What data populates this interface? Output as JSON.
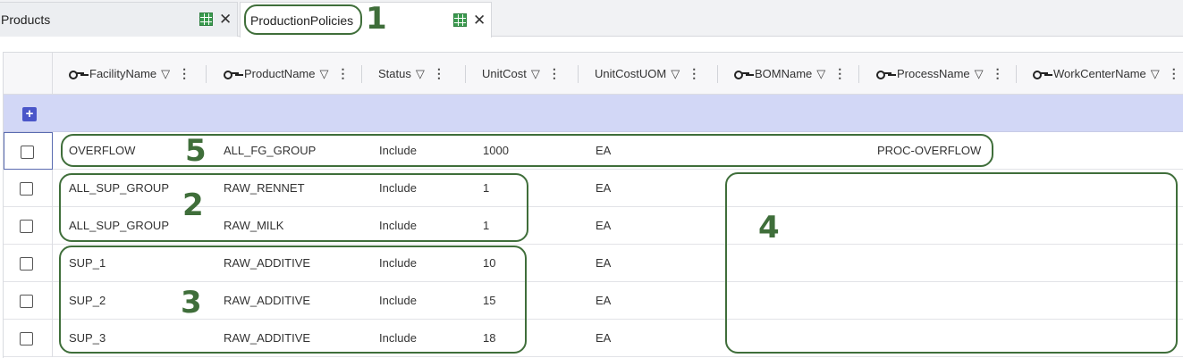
{
  "tabs": [
    {
      "label": "Products"
    },
    {
      "label": "ProductionPolicies"
    }
  ],
  "columns": [
    {
      "label": "FacilityName",
      "key": true
    },
    {
      "label": "ProductName",
      "key": true
    },
    {
      "label": "Status",
      "key": false
    },
    {
      "label": "UnitCost",
      "key": false
    },
    {
      "label": "UnitCostUOM",
      "key": false
    },
    {
      "label": "BOMName",
      "key": true
    },
    {
      "label": "ProcessName",
      "key": true
    },
    {
      "label": "WorkCenterName",
      "key": true
    }
  ],
  "rows": [
    {
      "facility": "OVERFLOW",
      "product": "ALL_FG_GROUP",
      "status": "Include",
      "unit_cost": "1000",
      "uom": "EA",
      "bom": "",
      "process": "PROC-OVERFLOW",
      "work_center": ""
    },
    {
      "facility": "ALL_SUP_GROUP",
      "product": "RAW_RENNET",
      "status": "Include",
      "unit_cost": "1",
      "uom": "EA",
      "bom": "",
      "process": "",
      "work_center": ""
    },
    {
      "facility": "ALL_SUP_GROUP",
      "product": "RAW_MILK",
      "status": "Include",
      "unit_cost": "1",
      "uom": "EA",
      "bom": "",
      "process": "",
      "work_center": ""
    },
    {
      "facility": "SUP_1",
      "product": "RAW_ADDITIVE",
      "status": "Include",
      "unit_cost": "10",
      "uom": "EA",
      "bom": "",
      "process": "",
      "work_center": ""
    },
    {
      "facility": "SUP_2",
      "product": "RAW_ADDITIVE",
      "status": "Include",
      "unit_cost": "15",
      "uom": "EA",
      "bom": "",
      "process": "",
      "work_center": ""
    },
    {
      "facility": "SUP_3",
      "product": "RAW_ADDITIVE",
      "status": "Include",
      "unit_cost": "18",
      "uom": "EA",
      "bom": "",
      "process": "",
      "work_center": ""
    }
  ],
  "annotations": {
    "n1": "1",
    "n2": "2",
    "n3": "3",
    "n4": "4",
    "n5": "5"
  },
  "colors": {
    "annotation": "#3f6e3a",
    "add_row_band": "#d2d7f6",
    "add_button": "#4a56c9",
    "tab_icon": "#3a9a4e"
  },
  "icons": {
    "tab_icon": "grid-icon",
    "tab_close": "close-icon",
    "column_key": "key-icon",
    "column_filter": "filter-icon",
    "column_menu": "menu-icon",
    "add_row": "plus-icon"
  }
}
